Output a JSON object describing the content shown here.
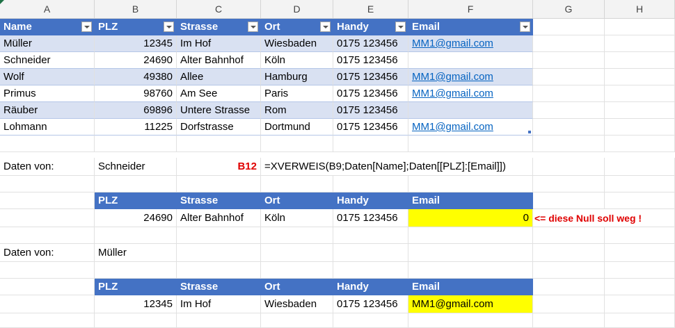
{
  "columns": [
    "A",
    "B",
    "C",
    "D",
    "E",
    "F",
    "G",
    "H"
  ],
  "table": {
    "headers": [
      "Name",
      "PLZ",
      "Strasse",
      "Ort",
      "Handy",
      "Email"
    ],
    "rows": [
      [
        "Müller",
        "12345",
        "Im Hof",
        "Wiesbaden",
        "0175 123456",
        "MM1@gmail.com "
      ],
      [
        "Schneider",
        "24690",
        "Alter Bahnhof",
        "Köln",
        "0175 123456",
        ""
      ],
      [
        "Wolf",
        "49380",
        "Allee",
        "Hamburg",
        "0175 123456",
        "MM1@gmail.com "
      ],
      [
        "Primus",
        "98760",
        "Am See",
        "Paris",
        "0175 123456",
        "MM1@gmail.com "
      ],
      [
        "Räuber",
        "69896",
        "Untere Strasse",
        "Rom",
        "0175 123456",
        ""
      ],
      [
        "Lohmann",
        "11225",
        "Dorfstrasse",
        "Dortmund",
        "0175 123456",
        "MM1@gmail.com "
      ]
    ]
  },
  "lookup1": {
    "label": "Daten von:",
    "name": "Schneider",
    "cell_ref": "B12",
    "formula": "=XVERWEIS(B9;Daten[Name];Daten[[PLZ]:[Email]])",
    "headers": [
      "PLZ",
      "Strasse",
      "Ort",
      "Handy",
      "Email"
    ],
    "values": [
      "24690",
      "Alter Bahnhof",
      "Köln",
      "0175 123456",
      "0"
    ],
    "note": "<= diese Null soll weg !"
  },
  "lookup2": {
    "label": "Daten von:",
    "name": "Müller",
    "headers": [
      "PLZ",
      "Strasse",
      "Ort",
      "Handy",
      "Email"
    ],
    "values": [
      "12345",
      "Im Hof",
      "Wiesbaden",
      "0175 123456",
      "MM1@gmail.com"
    ]
  },
  "colors": {
    "header_blue": "#4472c4",
    "band": "#d9e1f2",
    "highlight": "#ffff00",
    "note_red": "#e00000",
    "link": "#0563c1"
  }
}
